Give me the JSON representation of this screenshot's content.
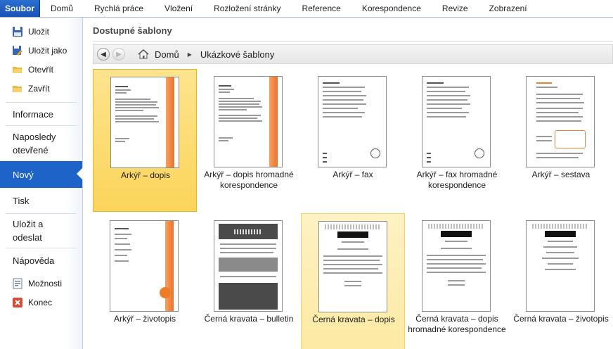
{
  "ribbon": {
    "file_tab": "Soubor",
    "tabs": [
      "Domů",
      "Rychlá práce",
      "Vložení",
      "Rozložení stránky",
      "Reference",
      "Korespondence",
      "Revize",
      "Zobrazení"
    ]
  },
  "nav": {
    "save": "Uložit",
    "save_as": "Uložit jako",
    "open": "Otevřít",
    "close": "Zavřít",
    "info": "Informace",
    "recent": "Naposledy otevřené",
    "new": "Nový",
    "print": "Tisk",
    "save_send": "Uložit a odeslat",
    "help": "Nápověda",
    "options": "Možnosti",
    "exit": "Konec"
  },
  "main": {
    "section_title": "Dostupné šablony",
    "breadcrumb": {
      "home": "Domů",
      "current": "Ukázkové šablony"
    },
    "templates": [
      {
        "label": "Arkýř – dopis",
        "state": "selected"
      },
      {
        "label": "Arkýř – dopis hromadné korespondence",
        "state": "normal"
      },
      {
        "label": "Arkýř – fax",
        "state": "normal"
      },
      {
        "label": "Arkýř – fax hromadné korespondence",
        "state": "normal"
      },
      {
        "label": "Arkýř – sestava",
        "state": "normal"
      },
      {
        "label": "Arkýř – životopis",
        "state": "normal"
      },
      {
        "label": "Černá kravata – bulletin",
        "state": "normal"
      },
      {
        "label": "Černá kravata – dopis",
        "state": "hovered"
      },
      {
        "label": "Černá kravata – dopis hromadné korespondence",
        "state": "normal"
      },
      {
        "label": "Černá kravata – životopis",
        "state": "normal"
      }
    ]
  },
  "colors": {
    "accent": "#1e64c8",
    "selected_tile": "#fbd45a",
    "hover_tile": "#fde9a1",
    "orange": "#e8732d"
  }
}
